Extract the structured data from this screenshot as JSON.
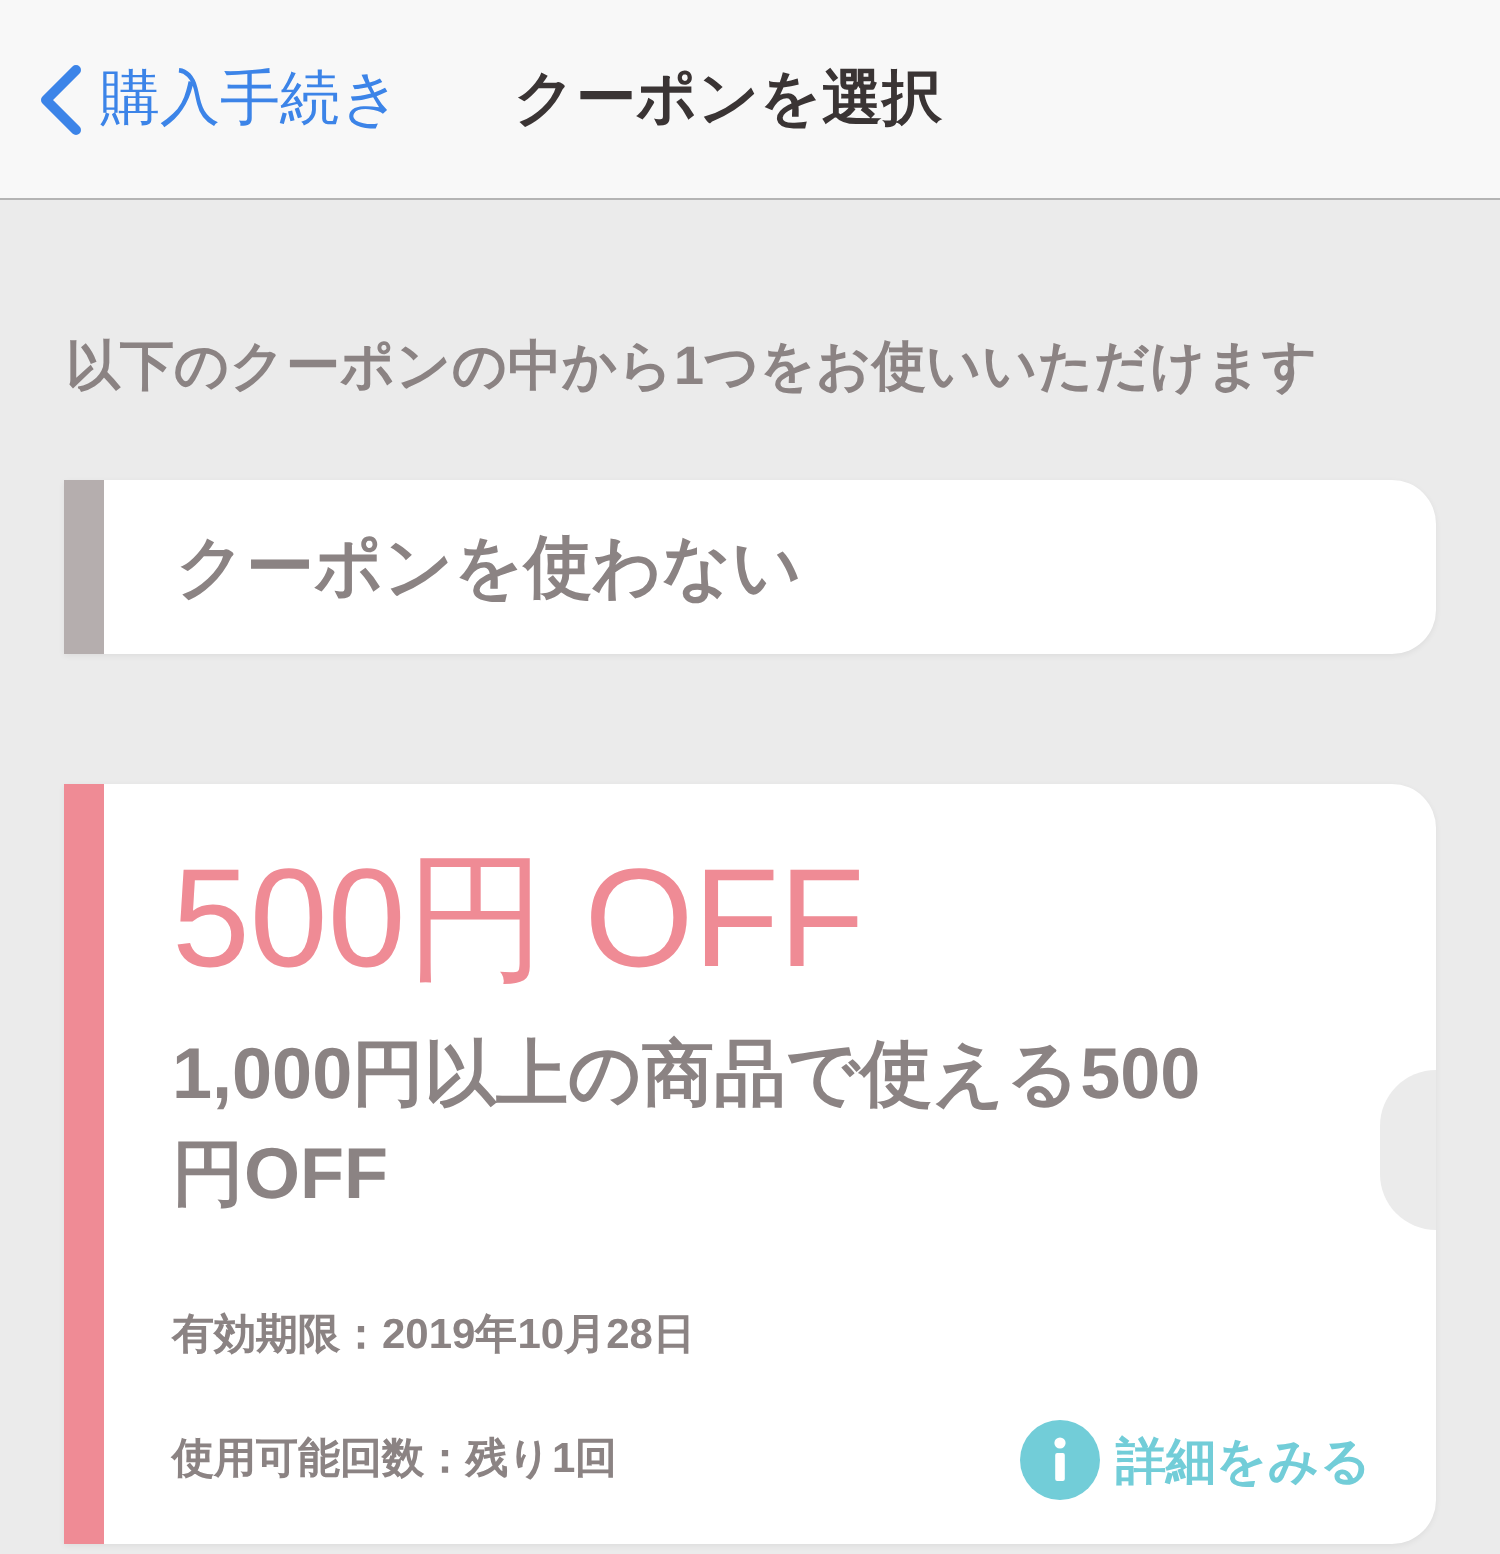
{
  "nav": {
    "back_label": "購入手続き",
    "title": "クーポンを選択"
  },
  "instruction": "以下のクーポンの中から1つをお使いいただけます",
  "coupons": [
    {
      "kind": "none",
      "label": "クーポンを使わない",
      "color": "#b5aeae"
    },
    {
      "kind": "discount",
      "title": "500円 OFF",
      "description": "1,000円以上の商品で使える500円OFF",
      "expiry": "有効期限：2019年10月28日",
      "remaining": "使用可能回数：残り1回",
      "details_link": "詳細をみる",
      "color": "#ef8b95"
    }
  ]
}
